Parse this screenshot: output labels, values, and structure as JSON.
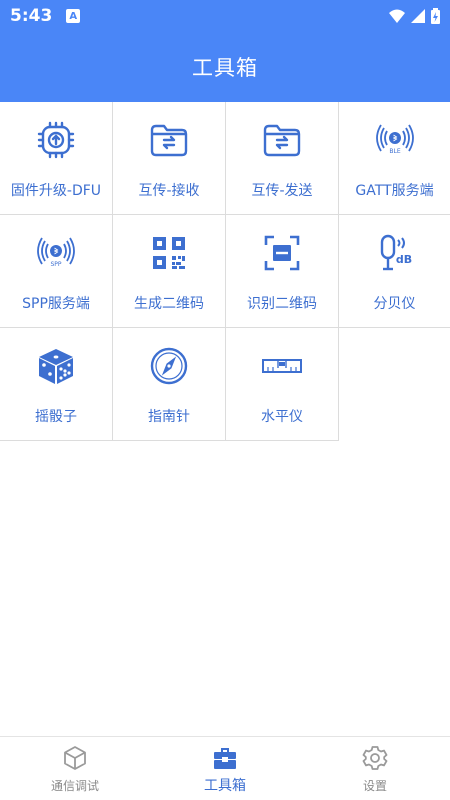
{
  "status_bar": {
    "time": "5:43"
  },
  "app_bar": {
    "title": "工具箱"
  },
  "tools": [
    {
      "label": "固件升级-DFU",
      "icon": "firmware-upgrade-icon"
    },
    {
      "label": "互传-接收",
      "icon": "folder-receive-icon"
    },
    {
      "label": "互传-发送",
      "icon": "folder-send-icon"
    },
    {
      "label": "GATT服务端",
      "icon": "ble-broadcast-icon"
    },
    {
      "label": "SPP服务端",
      "icon": "spp-broadcast-icon"
    },
    {
      "label": "生成二维码",
      "icon": "qr-code-icon"
    },
    {
      "label": "识别二维码",
      "icon": "scan-icon"
    },
    {
      "label": "分贝仪",
      "icon": "microphone-db-icon"
    },
    {
      "label": "摇骰子",
      "icon": "dice-icon"
    },
    {
      "label": "指南针",
      "icon": "compass-icon"
    },
    {
      "label": "水平仪",
      "icon": "level-icon"
    }
  ],
  "bottom_nav": {
    "tabs": [
      {
        "label": "通信调试",
        "icon": "cube-icon",
        "active": false
      },
      {
        "label": "工具箱",
        "icon": "toolbox-icon",
        "active": true
      },
      {
        "label": "设置",
        "icon": "gear-icon",
        "active": false
      }
    ]
  },
  "colors": {
    "primary": "#4a86f7",
    "accent_text": "#3d6fd0",
    "inactive": "#8a8a8a"
  }
}
